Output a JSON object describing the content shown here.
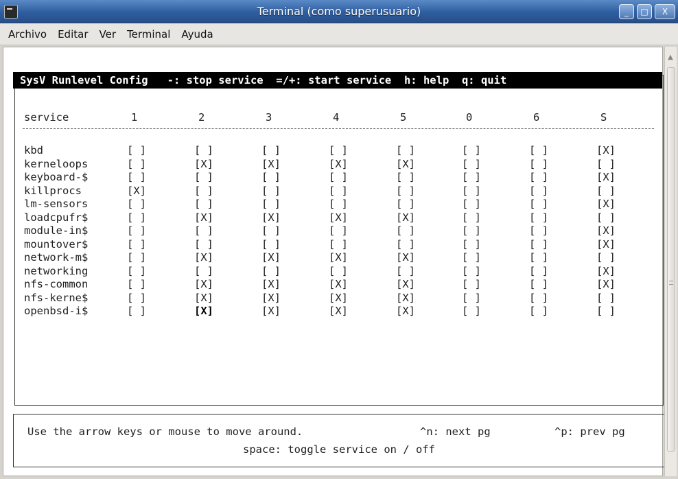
{
  "window": {
    "title": "Terminal (como superusuario)",
    "minimize": "_",
    "maximize": "□",
    "close": "X"
  },
  "menu": [
    "Archivo",
    "Editar",
    "Ver",
    "Terminal",
    "Ayuda"
  ],
  "header": {
    "title": "SysV Runlevel Config",
    "stop": "-: stop service",
    "start": "=/+: start service",
    "help": "h: help",
    "quit": "q: quit"
  },
  "columns": [
    "service",
    "1",
    "2",
    "3",
    "4",
    "5",
    "0",
    "6",
    "S"
  ],
  "services": [
    {
      "name": "kbd",
      "levels": [
        "[ ]",
        "[ ]",
        "[ ]",
        "[ ]",
        "[ ]",
        "[ ]",
        "[ ]",
        "[X]"
      ]
    },
    {
      "name": "kerneloops",
      "levels": [
        "[ ]",
        "[X]",
        "[X]",
        "[X]",
        "[X]",
        "[ ]",
        "[ ]",
        "[ ]"
      ]
    },
    {
      "name": "keyboard-$",
      "levels": [
        "[ ]",
        "[ ]",
        "[ ]",
        "[ ]",
        "[ ]",
        "[ ]",
        "[ ]",
        "[X]"
      ]
    },
    {
      "name": "killprocs",
      "levels": [
        "[X]",
        "[ ]",
        "[ ]",
        "[ ]",
        "[ ]",
        "[ ]",
        "[ ]",
        "[ ]"
      ]
    },
    {
      "name": "lm-sensors",
      "levels": [
        "[ ]",
        "[ ]",
        "[ ]",
        "[ ]",
        "[ ]",
        "[ ]",
        "[ ]",
        "[X]"
      ]
    },
    {
      "name": "loadcpufr$",
      "levels": [
        "[ ]",
        "[X]",
        "[X]",
        "[X]",
        "[X]",
        "[ ]",
        "[ ]",
        "[ ]"
      ]
    },
    {
      "name": "module-in$",
      "levels": [
        "[ ]",
        "[ ]",
        "[ ]",
        "[ ]",
        "[ ]",
        "[ ]",
        "[ ]",
        "[X]"
      ]
    },
    {
      "name": "mountover$",
      "levels": [
        "[ ]",
        "[ ]",
        "[ ]",
        "[ ]",
        "[ ]",
        "[ ]",
        "[ ]",
        "[X]"
      ]
    },
    {
      "name": "network-m$",
      "levels": [
        "[ ]",
        "[X]",
        "[X]",
        "[X]",
        "[X]",
        "[ ]",
        "[ ]",
        "[ ]"
      ]
    },
    {
      "name": "networking",
      "levels": [
        "[ ]",
        "[ ]",
        "[ ]",
        "[ ]",
        "[ ]",
        "[ ]",
        "[ ]",
        "[X]"
      ]
    },
    {
      "name": "nfs-common",
      "levels": [
        "[ ]",
        "[X]",
        "[X]",
        "[X]",
        "[X]",
        "[ ]",
        "[ ]",
        "[X]"
      ]
    },
    {
      "name": "nfs-kerne$",
      "levels": [
        "[ ]",
        "[X]",
        "[X]",
        "[X]",
        "[X]",
        "[ ]",
        "[ ]",
        "[ ]"
      ]
    },
    {
      "name": "openbsd-i$",
      "levels": [
        "[ ]",
        "[X]",
        "[X]",
        "[X]",
        "[X]",
        "[ ]",
        "[ ]",
        "[ ]"
      ],
      "focused_level": 1
    }
  ],
  "help": {
    "line1": "Use the arrow keys or mouse to move around.",
    "next": "^n: next pg",
    "prev": "^p: prev pg",
    "line2": "space: toggle service on / off"
  }
}
